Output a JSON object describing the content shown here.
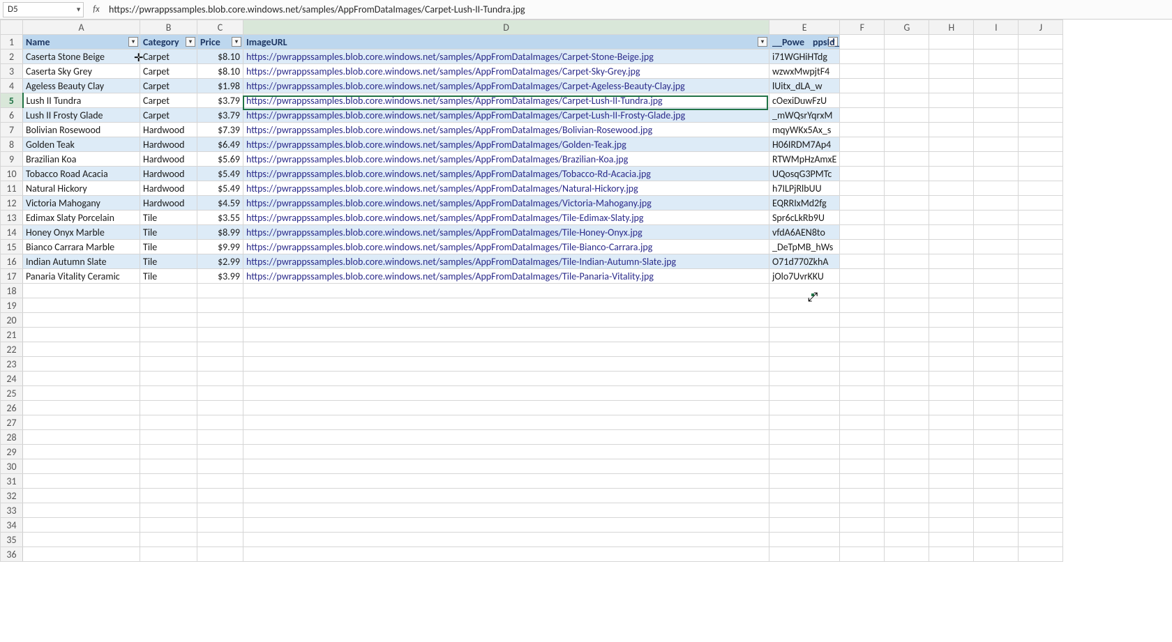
{
  "namebox": {
    "value": "D5"
  },
  "formula": {
    "label": "fx",
    "value": "https://pwrappssamples.blob.core.windows.net/samples/AppFromDataImages/Carpet-Lush-II-Tundra.jpg"
  },
  "columns": {
    "row_header": "",
    "letters": [
      "A",
      "B",
      "C",
      "D",
      "E",
      "F",
      "G",
      "H",
      "I",
      "J"
    ],
    "widths": {
      "rh": 32,
      "A": 168,
      "B": 82,
      "C": 66,
      "D": 754,
      "E": 64,
      "F": 64,
      "G": 64,
      "H": 64,
      "I": 64,
      "J": 64
    }
  },
  "headers": {
    "A": "Name",
    "B": "Category",
    "C": "Price",
    "D": "ImageURL",
    "E": "__PowerAppsId__"
  },
  "rows": [
    {
      "n": "Caserta Stone Beige",
      "c": "Carpet",
      "p": "$8.10",
      "u": "https://pwrappssamples.blob.core.windows.net/samples/AppFromDataImages/Carpet-Stone-Beige.jpg",
      "id": "i71WGHiHTdg"
    },
    {
      "n": "Caserta Sky Grey",
      "c": "Carpet",
      "p": "$8.10",
      "u": "https://pwrappssamples.blob.core.windows.net/samples/AppFromDataImages/Carpet-Sky-Grey.jpg",
      "id": "wzwxMwpjtF4"
    },
    {
      "n": "Ageless Beauty Clay",
      "c": "Carpet",
      "p": "$1.98",
      "u": "https://pwrappssamples.blob.core.windows.net/samples/AppFromDataImages/Carpet-Ageless-Beauty-Clay.jpg",
      "id": "lUitx_dLA_w"
    },
    {
      "n": "Lush II Tundra",
      "c": "Carpet",
      "p": "$3.79",
      "u": "https://pwrappssamples.blob.core.windows.net/samples/AppFromDataImages/Carpet-Lush-II-Tundra.jpg",
      "id": "cOexiDuwFzU"
    },
    {
      "n": "Lush II Frosty Glade",
      "c": "Carpet",
      "p": "$3.79",
      "u": "https://pwrappssamples.blob.core.windows.net/samples/AppFromDataImages/Carpet-Lush-II-Frosty-Glade.jpg",
      "id": "_mWQsrYqrxM"
    },
    {
      "n": "Bolivian Rosewood",
      "c": "Hardwood",
      "p": "$7.39",
      "u": "https://pwrappssamples.blob.core.windows.net/samples/AppFromDataImages/Bolivian-Rosewood.jpg",
      "id": "mqyWKx5Ax_s"
    },
    {
      "n": "Golden Teak",
      "c": "Hardwood",
      "p": "$6.49",
      "u": "https://pwrappssamples.blob.core.windows.net/samples/AppFromDataImages/Golden-Teak.jpg",
      "id": "H06IRDM7Ap4"
    },
    {
      "n": "Brazilian Koa",
      "c": "Hardwood",
      "p": "$5.69",
      "u": "https://pwrappssamples.blob.core.windows.net/samples/AppFromDataImages/Brazilian-Koa.jpg",
      "id": "RTWMpHzAmxE"
    },
    {
      "n": "Tobacco Road Acacia",
      "c": "Hardwood",
      "p": "$5.49",
      "u": "https://pwrappssamples.blob.core.windows.net/samples/AppFromDataImages/Tobacco-Rd-Acacia.jpg",
      "id": "UQosqG3PMTc"
    },
    {
      "n": "Natural Hickory",
      "c": "Hardwood",
      "p": "$5.49",
      "u": "https://pwrappssamples.blob.core.windows.net/samples/AppFromDataImages/Natural-Hickory.jpg",
      "id": "h7ILPjRlbUU"
    },
    {
      "n": "Victoria Mahogany",
      "c": "Hardwood",
      "p": "$4.59",
      "u": "https://pwrappssamples.blob.core.windows.net/samples/AppFromDataImages/Victoria-Mahogany.jpg",
      "id": "EQRRIxMd2fg"
    },
    {
      "n": "Edimax Slaty Porcelain",
      "c": "Tile",
      "p": "$3.55",
      "u": "https://pwrappssamples.blob.core.windows.net/samples/AppFromDataImages/Tile-Edimax-Slaty.jpg",
      "id": "Spr6cLkRb9U"
    },
    {
      "n": "Honey Onyx Marble",
      "c": "Tile",
      "p": "$8.99",
      "u": "https://pwrappssamples.blob.core.windows.net/samples/AppFromDataImages/Tile-Honey-Onyx.jpg",
      "id": "vfdA6AEN8to"
    },
    {
      "n": "Bianco Carrara Marble",
      "c": "Tile",
      "p": "$9.99",
      "u": "https://pwrappssamples.blob.core.windows.net/samples/AppFromDataImages/Tile-Bianco-Carrara.jpg",
      "id": "_DeTpMB_hWs"
    },
    {
      "n": "Indian Autumn Slate",
      "c": "Tile",
      "p": "$2.99",
      "u": "https://pwrappssamples.blob.core.windows.net/samples/AppFromDataImages/Tile-Indian-Autumn-Slate.jpg",
      "id": "O71d770ZkhA"
    },
    {
      "n": "Panaria Vitality Ceramic",
      "c": "Tile",
      "p": "$3.99",
      "u": "https://pwrappssamples.blob.core.windows.net/samples/AppFromDataImages/Tile-Panaria-Vitality.jpg",
      "id": "jOlo7UvrKKU"
    }
  ],
  "empty_rows_to": 36,
  "active": {
    "cell": "D5",
    "row_index": 5,
    "col": "D"
  },
  "cursor_glyph": "⬚"
}
